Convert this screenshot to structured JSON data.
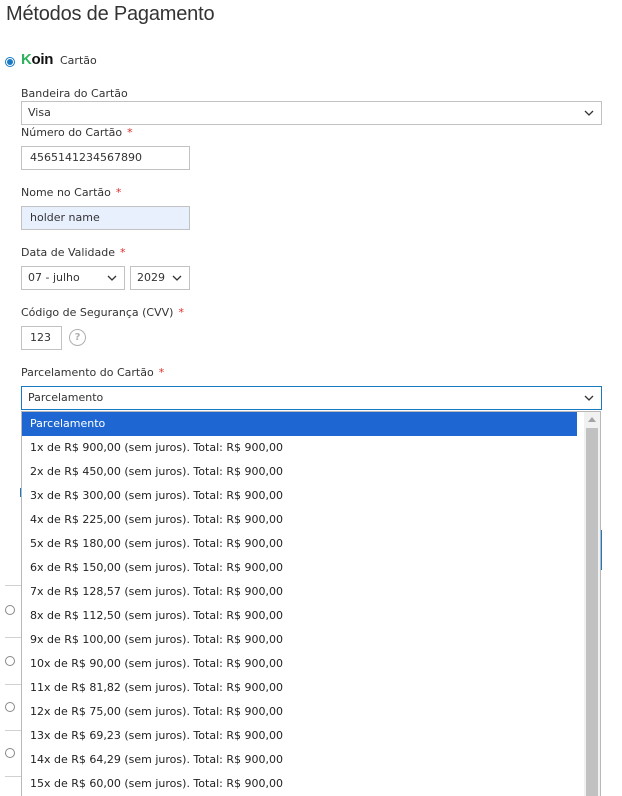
{
  "page": {
    "title": "Métodos de Pagamento"
  },
  "payment_method": {
    "logo": "Koin",
    "label": "Cartão"
  },
  "form": {
    "brand": {
      "label": "Bandeira do Cartão",
      "value": "Visa"
    },
    "number": {
      "label": "Número do Cartão",
      "value": "4565141234567890"
    },
    "name": {
      "label": "Nome no Cartão",
      "value": "holder name"
    },
    "expiry": {
      "label": "Data de Validade",
      "month": "07 - julho",
      "year": "2029"
    },
    "cvv": {
      "label": "Código de Segurança (CVV)",
      "value": "123",
      "help": "?"
    },
    "installments": {
      "label": "Parcelamento do Cartão",
      "value": "Parcelamento",
      "options": [
        "Parcelamento",
        "1x de R$ 900,00 (sem juros). Total: R$ 900,00",
        "2x de R$ 450,00 (sem juros). Total: R$ 900,00",
        "3x de R$ 300,00 (sem juros). Total: R$ 900,00",
        "4x de R$ 225,00 (sem juros). Total: R$ 900,00",
        "5x de R$ 180,00 (sem juros). Total: R$ 900,00",
        "6x de R$ 150,00 (sem juros). Total: R$ 900,00",
        "7x de R$ 128,57 (sem juros). Total: R$ 900,00",
        "8x de R$ 112,50 (sem juros). Total: R$ 900,00",
        "9x de R$ 100,00 (sem juros). Total: R$ 900,00",
        "10x de R$ 90,00 (sem juros). Total: R$ 900,00",
        "11x de R$ 81,82 (sem juros). Total: R$ 900,00",
        "12x de R$ 75,00 (sem juros). Total: R$ 900,00",
        "13x de R$ 69,23 (sem juros). Total: R$ 900,00",
        "14x de R$ 64,29 (sem juros). Total: R$ 900,00",
        "15x de R$ 60,00 (sem juros). Total: R$ 900,00"
      ]
    },
    "required_marker": "*"
  },
  "colors": {
    "accent": "#1979c3",
    "required": "#e02b27",
    "option_selected": "#1e67d2",
    "autofill": "#e8f0fe",
    "koin_green": "#2fb15d"
  }
}
